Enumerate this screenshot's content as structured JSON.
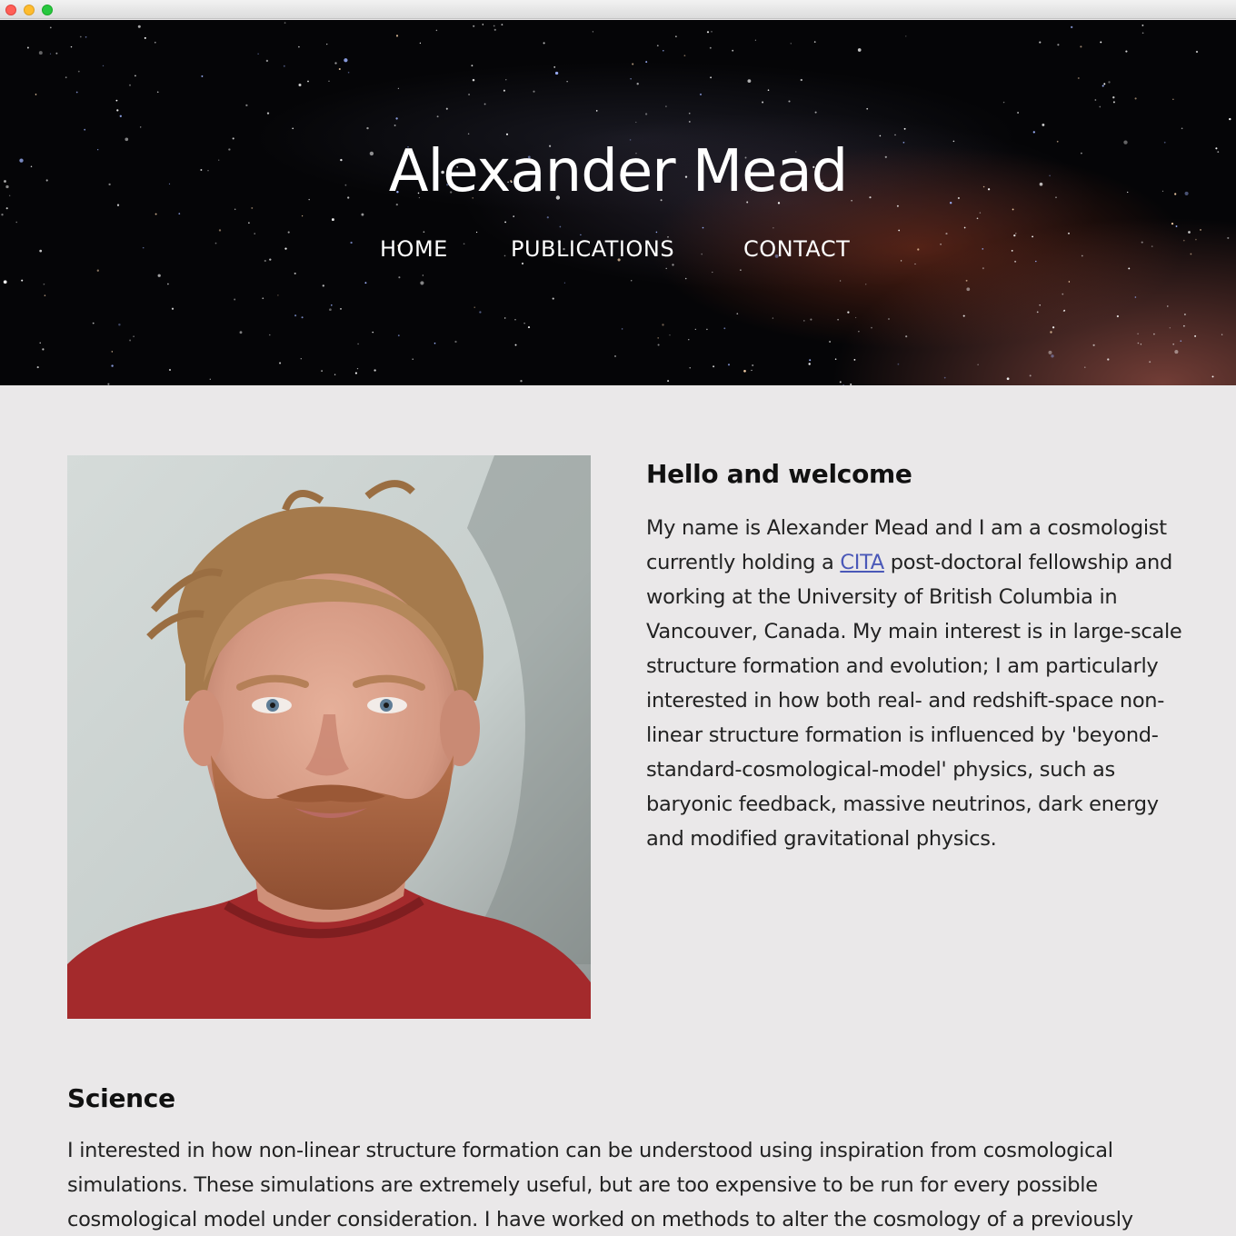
{
  "site": {
    "title": "Alexander Mead"
  },
  "nav": {
    "items": [
      "HOME",
      "PUBLICATIONS",
      "CONTACT"
    ]
  },
  "welcome": {
    "heading": "Hello and welcome",
    "before_link": "My name is Alexander Mead and I am a cosmologist currently holding a ",
    "link_text": "CITA",
    "after_link": " post-doctoral fellowship and working at the University of British Columbia in Vancouver, Canada. My main interest is in large-scale structure formation and evolution; I am particularly interested in how both real- and redshift-space non-linear structure formation is influenced by 'beyond-standard-cosmological-model' physics, such as baryonic feedback, massive neutrinos, dark energy and modified gravitational physics."
  },
  "science": {
    "heading": "Science",
    "body": "I interested in how non-linear structure formation can be understood using inspiration from cosmological simulations. These simulations are extremely useful, but are too expensive to be run for every possible cosmological model under consideration. I have worked on methods to alter the cosmology of a previously"
  },
  "colors": {
    "background": "#eae8e9",
    "link": "#4a58b8",
    "shirt": "#a42a2c"
  }
}
